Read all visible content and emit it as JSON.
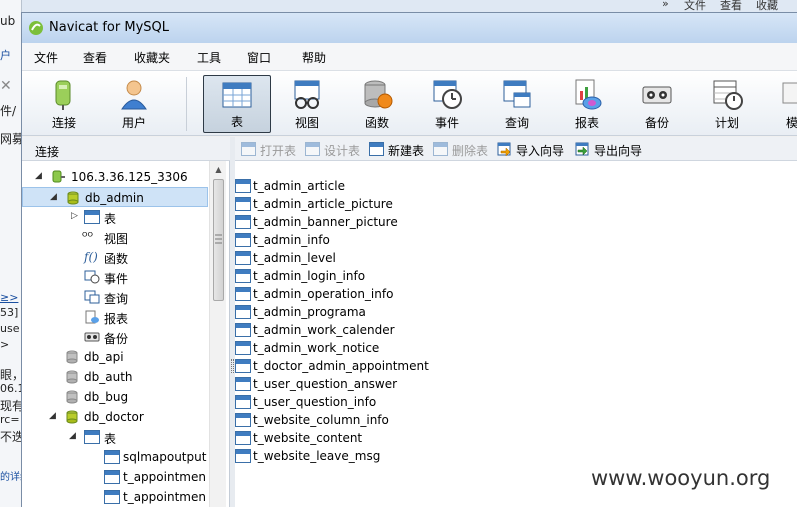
{
  "background_app": {
    "left_fragments": [
      "ub",
      "户",
      "件/",
      "网募",
      "≥>",
      "53]",
      "use",
      ">",
      "眼，",
      "06.1",
      "现有",
      "rc=",
      "不迭",
      "的详细"
    ],
    "top_fragments": [
      "»",
      "文件",
      "查看",
      "收藏"
    ]
  },
  "window": {
    "title": "Navicat for MySQL"
  },
  "menu": [
    "文件",
    "查看",
    "收藏夹",
    "工具",
    "窗口",
    "帮助"
  ],
  "toolbar": [
    {
      "label": "连接",
      "icon": "connection-icon"
    },
    {
      "label": "用户",
      "icon": "user-icon"
    },
    {
      "label": "表",
      "icon": "table-icon",
      "active": true
    },
    {
      "label": "视图",
      "icon": "view-icon"
    },
    {
      "label": "函数",
      "icon": "function-icon"
    },
    {
      "label": "事件",
      "icon": "event-icon"
    },
    {
      "label": "查询",
      "icon": "query-icon"
    },
    {
      "label": "报表",
      "icon": "report-icon"
    },
    {
      "label": "备份",
      "icon": "backup-icon"
    },
    {
      "label": "计划",
      "icon": "schedule-icon"
    },
    {
      "label": "模",
      "icon": "model-icon"
    }
  ],
  "left_pane": {
    "header": "连接",
    "connection": "106.3.36.125_3306",
    "tree": [
      {
        "label": "db_admin",
        "type": "database-open",
        "selected": true
      },
      {
        "label": "表",
        "type": "tables"
      },
      {
        "label": "视图",
        "type": "views"
      },
      {
        "label": "函数",
        "type": "functions"
      },
      {
        "label": "事件",
        "type": "events"
      },
      {
        "label": "查询",
        "type": "queries"
      },
      {
        "label": "报表",
        "type": "reports"
      },
      {
        "label": "备份",
        "type": "backups"
      },
      {
        "label": "db_api",
        "type": "database"
      },
      {
        "label": "db_auth",
        "type": "database"
      },
      {
        "label": "db_bug",
        "type": "database"
      },
      {
        "label": "db_doctor",
        "type": "database-open"
      },
      {
        "label": "表",
        "type": "tables"
      },
      {
        "label": "sqlmapoutput",
        "type": "table"
      },
      {
        "label": "t_appointmen",
        "type": "table"
      },
      {
        "label": "t_appointmen",
        "type": "table"
      }
    ]
  },
  "object_toolbar": [
    {
      "label": "打开表",
      "enabled": false,
      "icon": "open-table-icon"
    },
    {
      "label": "设计表",
      "enabled": false,
      "icon": "design-table-icon"
    },
    {
      "label": "新建表",
      "enabled": true,
      "icon": "new-table-icon"
    },
    {
      "label": "删除表",
      "enabled": false,
      "icon": "delete-table-icon"
    },
    {
      "label": "导入向导",
      "enabled": true,
      "icon": "import-wizard-icon"
    },
    {
      "label": "导出向导",
      "enabled": true,
      "icon": "export-wizard-icon"
    }
  ],
  "tables": [
    "t_admin_article",
    "t_admin_article_picture",
    "t_admin_banner_picture",
    "t_admin_info",
    "t_admin_level",
    "t_admin_login_info",
    "t_admin_operation_info",
    "t_admin_programa",
    "t_admin_work_calender",
    "t_admin_work_notice",
    "t_doctor_admin_appointment",
    "t_user_question_answer",
    "t_user_question_info",
    "t_website_column_info",
    "t_website_content",
    "t_website_leave_msg"
  ],
  "watermark": "www.wooyun.org"
}
